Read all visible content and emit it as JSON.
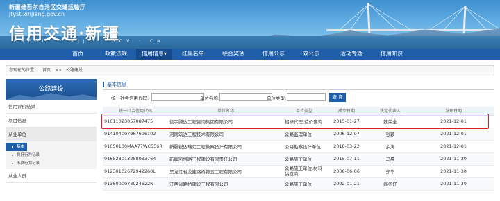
{
  "header": {
    "dept_title": "新疆维吾尔自治区交通运输厅",
    "url": "jtyst.xinjiang.gov.cn",
    "logo_title": "信用交通·新疆",
    "logo_en": "CREDIT · XJJT · GOV · CN"
  },
  "nav": {
    "items": [
      {
        "label": "首页"
      },
      {
        "label": "政策法规"
      },
      {
        "label": "信用信息▾"
      },
      {
        "label": "红黑名单"
      },
      {
        "label": "联合奖惩"
      },
      {
        "label": "信用公示"
      },
      {
        "label": "双公示"
      },
      {
        "label": "活动专题"
      },
      {
        "label": "信用知识"
      }
    ]
  },
  "breadcrumb": {
    "prefix": "您现在的位置：",
    "home": "首页",
    "sep": ">>",
    "current": "公路建设"
  },
  "sidebar": {
    "title": "公路建设",
    "items": [
      {
        "label": "信用评价结果"
      },
      {
        "label": "项目信息"
      },
      {
        "label": "从业单位"
      },
      {
        "label": "从业人员"
      }
    ],
    "subitems": [
      {
        "label": "基本信息"
      },
      {
        "label": "良好行为记录"
      },
      {
        "label": "不良行为记录"
      }
    ]
  },
  "main": {
    "section_title": "基本信息",
    "search": {
      "code_label": "统一社会信用代码:",
      "name_label": "单位名称:",
      "type_label": "单位类型:",
      "button": "查 询"
    },
    "table": {
      "headers": [
        "统一社会信用代码",
        "单位名称",
        "单位类型",
        "成立日期",
        "法定代表人",
        "发布日期"
      ],
      "rows": [
        [
          "91611023057087475",
          "信宇腾达工程咨询集团有限公司",
          "招标代理,造价咨询",
          "2015-01-27",
          "魏荣全",
          "2021-12-01"
        ],
        [
          "91410400796760610​2",
          "河南筑达工程技术有限公司",
          "公路监理单位",
          "2006-12-07",
          "张颖",
          "2021-12-01"
        ],
        [
          "91650100MAA77WC556R",
          "新疆锐达瑞汇工程勘察设计有限公司",
          "公路勘察设计单位",
          "2018-03-22",
          "余涛",
          "2021-12-01"
        ],
        [
          "916523013288033764",
          "新疆凯悦路工程建设有限责任公司",
          "公路施工单位",
          "2015-07-11",
          "马晨",
          "2021-11-30"
        ],
        [
          "912301026729422​60L",
          "黑龙江省龙建路桥第五工程有限公司",
          "公路施工单位,材料供应商",
          "2008-06-06",
          "郑华",
          "2021-11-30"
        ],
        [
          "913600007392462​2N",
          "江西省路桥建设工程有限公司",
          "公路施工单位",
          "2002-01-21",
          "郝冬仔",
          "2021-11-30"
        ]
      ]
    }
  }
}
